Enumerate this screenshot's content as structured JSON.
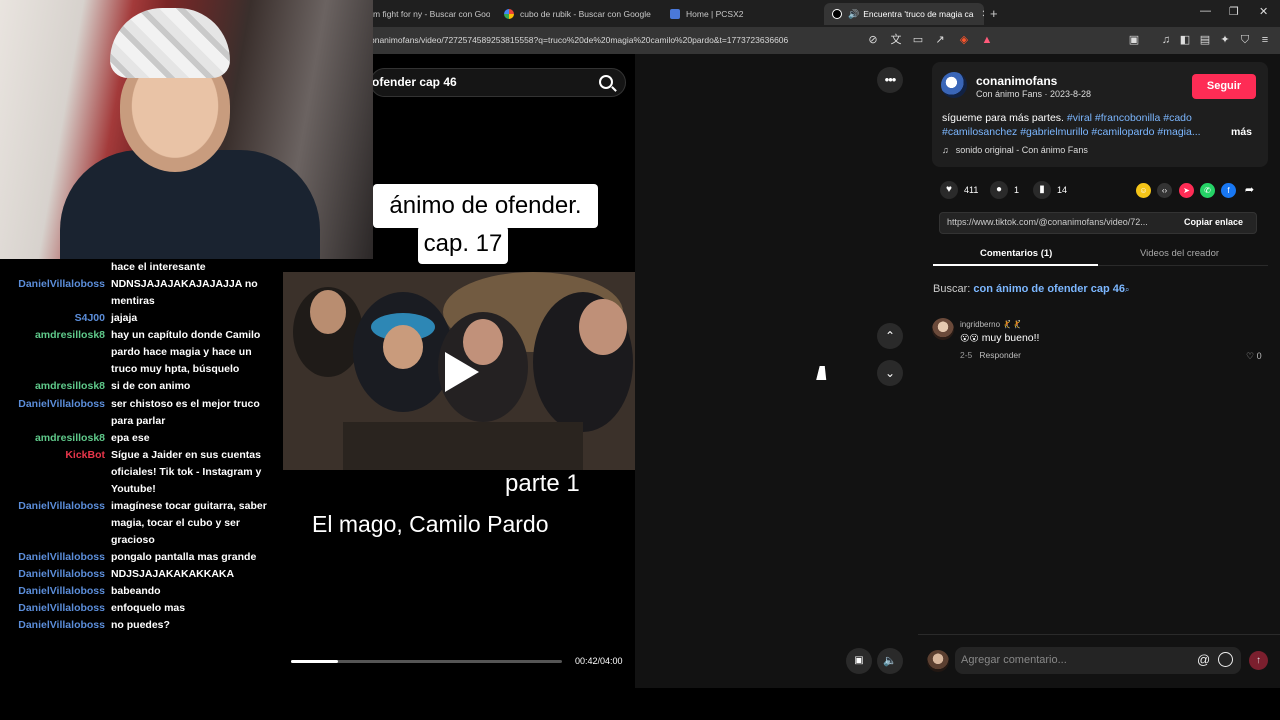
{
  "browser": {
    "tabs": [
      {
        "label": "m fight for ny - Buscar con Goo",
        "active": false
      },
      {
        "label": "cubo de rubik - Buscar con Google",
        "active": false
      },
      {
        "label": "Home | PCSX2",
        "active": false
      },
      {
        "label": "Encuentra 'truco de magia ca",
        "active": true
      }
    ],
    "url": "onanimofans/video/7272574589253815558?q=truco%20de%20magia%20camilo%20pardo&t=1773723636606"
  },
  "video": {
    "search_text": "ofender cap 46",
    "title_line1": "ánimo de ofender.",
    "title_line2": "cap. 17",
    "caption_part": "parte 1",
    "caption_main": "El mago, Camilo Pardo",
    "time": "00:42/04:00",
    "progress": 0.175
  },
  "post": {
    "author": "conanimofans",
    "author_sub": "Con ánimo Fans · 2023-8-28",
    "follow_label": "Seguir",
    "desc_text": "sígueme para más partes. ",
    "tags": [
      "#viral",
      "#francobonilla",
      "#cado",
      "#camilosanchez",
      "#gabrielmurillo",
      "#camilopardo",
      "#magia..."
    ],
    "more_label": "más",
    "sound": "sonido original - Con ánimo Fans",
    "likes": "411",
    "comments": "1",
    "saves": "14",
    "link": "https://www.tiktok.com/@conanimofans/video/72...",
    "copy_label": "Copiar enlace",
    "tab_comments": "Comentarios (1)",
    "tab_creator": "Videos del creador",
    "search_label": "Buscar:",
    "search_term": "con ánimo de ofender cap 46",
    "comment": {
      "user": "ingridberno",
      "text": "muy bueno!!",
      "date": "2-5",
      "reply": "Responder",
      "likes": "0"
    },
    "add_comment_placeholder": "Agregar comentario..."
  },
  "chat": [
    {
      "user": "",
      "color": "#ffffff",
      "text": "hace el interesante"
    },
    {
      "user": "DanielVillaloboss",
      "color": "#5b8dd9",
      "text": "NDNSJAJAJAKAJAJAJJA no mentiras"
    },
    {
      "user": "S4J00",
      "color": "#5b8dd9",
      "text": "jajaja"
    },
    {
      "user": "amdresillosk8",
      "color": "#5fc98a",
      "text": "hay un capítulo donde Camilo pardo hace magia y hace un truco muy hpta, búsquelo"
    },
    {
      "user": "amdresillosk8",
      "color": "#5fc98a",
      "text": "si de con animo"
    },
    {
      "user": "DanielVillaloboss",
      "color": "#5b8dd9",
      "text": "ser chistoso es el mejor truco para parlar"
    },
    {
      "user": "amdresillosk8",
      "color": "#5fc98a",
      "text": "epa ese"
    },
    {
      "user": "KickBot",
      "color": "#e8364b",
      "text": "Sígue a Jaider en sus cuentas oficiales! Tik tok - Instagram y Youtube!"
    },
    {
      "user": "DanielVillaloboss",
      "color": "#5b8dd9",
      "text": "imagínese tocar guitarra, saber magia, tocar el cubo y ser gracioso"
    },
    {
      "user": "DanielVillaloboss",
      "color": "#5b8dd9",
      "text": "pongalo pantalla mas grande"
    },
    {
      "user": "DanielVillaloboss",
      "color": "#5b8dd9",
      "text": "NDJSJAJAKAKAKKAKA"
    },
    {
      "user": "DanielVillaloboss",
      "color": "#5b8dd9",
      "text": "babeando"
    },
    {
      "user": "DanielVillaloboss",
      "color": "#5b8dd9",
      "text": "enfoquelo mas"
    },
    {
      "user": "DanielVillaloboss",
      "color": "#5b8dd9",
      "text": "no puedes?"
    }
  ]
}
